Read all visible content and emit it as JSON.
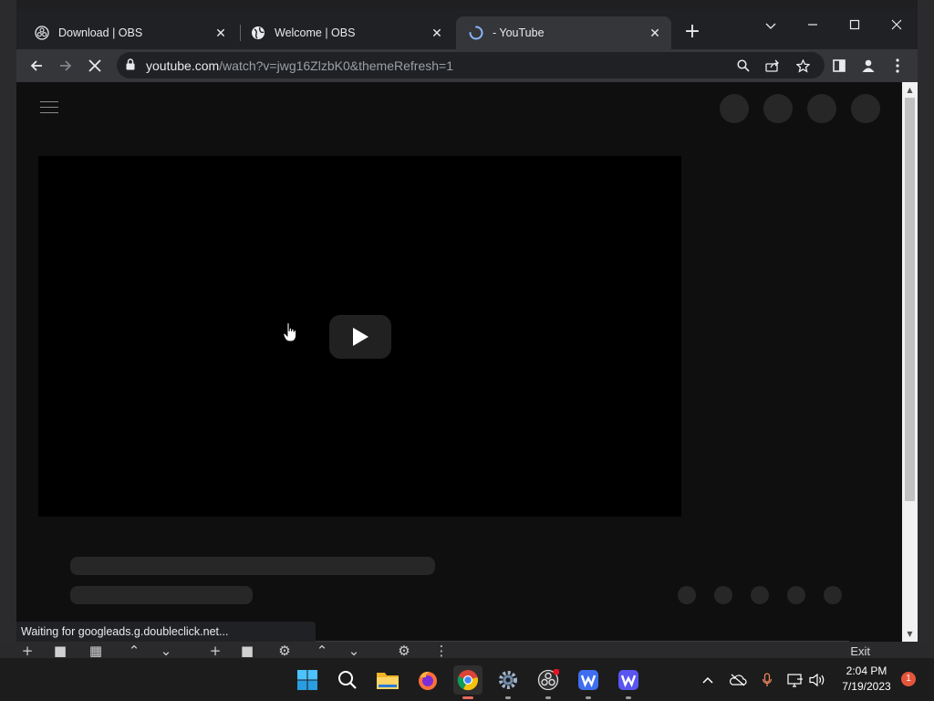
{
  "tabs": [
    {
      "label": "Download | OBS",
      "favicon": "obs-icon"
    },
    {
      "label": "Welcome | OBS",
      "favicon": "globe-icon"
    },
    {
      "label": "- YouTube",
      "favicon": "loading-spinner-icon",
      "active": true
    }
  ],
  "address_bar": {
    "host": "youtube.com",
    "path": "/watch?v=jwg16ZlzbK0&themeRefresh=1"
  },
  "status_text": "Waiting for googleads.g.doubleclick.net...",
  "obs": {
    "exit_label": "Exit"
  },
  "taskbar": {
    "time": "2:04 PM",
    "date": "7/19/2023",
    "notification_count": "1"
  },
  "colors": {
    "page_bg": "#0f0f0f",
    "chrome_frame": "#202124",
    "chrome_toolbar": "#35363a",
    "skeleton": "#272727",
    "spinner": "#8ab4f8"
  }
}
